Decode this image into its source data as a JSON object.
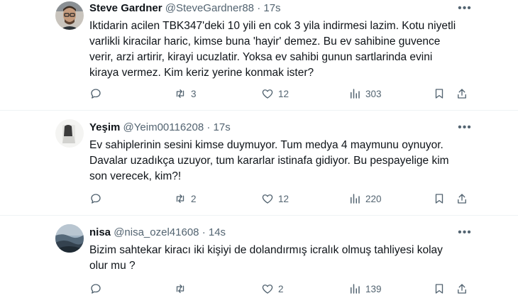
{
  "tweets": [
    {
      "name": "Steve Gardner",
      "handle": "@SteveGardner88",
      "dot": "·",
      "time": "17s",
      "lines": [
        "Iktidarin acilen TBK347'deki 10 yili en cok 3 yila indirmesi lazim. Kotu niyetli",
        "varlikli kiracilar haric, kimse buna 'hayir' demez. Bu ev sahibine guvence",
        "verir, arzi artirir, kirayi ucuzlatir. Yoksa ev sahibi gunun sartlarinda evini",
        "kiraya vermez. Kim keriz yerine konmak ister?"
      ],
      "replies": "",
      "retweets": "3",
      "likes": "12",
      "views": "303"
    },
    {
      "name": "Yeşim",
      "handle": "@Yeim00116208",
      "dot": "·",
      "time": "17s",
      "lines": [
        "Ev sahiplerinin sesini kimse duymuyor. Tum medya 4 maymunu oynuyor.",
        "Davalar uzadıkça uzuyor, tum kararlar istinafa gidiyor. Bu pespayelige kim",
        "son verecek, kim?!"
      ],
      "replies": "",
      "retweets": "2",
      "likes": "12",
      "views": "220"
    },
    {
      "name": "nisa",
      "handle": "@nisa_ozel41608",
      "dot": "·",
      "time": "14s",
      "lines": [
        "Bizim sahtekar kiracı iki kişiyi de dolandırmış icralık olmuş tahliyesi kolay",
        "olur mu ?"
      ],
      "replies": "",
      "retweets": "",
      "likes": "2",
      "views": "139"
    }
  ],
  "icons": {
    "reply": "reply-icon",
    "retweet": "retweet-icon",
    "like": "heart-icon",
    "views": "views-icon",
    "bookmark": "bookmark-icon",
    "share": "share-icon",
    "more": "more-icon"
  },
  "colors": {
    "text": "#0f1419",
    "secondary": "#536471",
    "divider": "#eff3f4"
  }
}
